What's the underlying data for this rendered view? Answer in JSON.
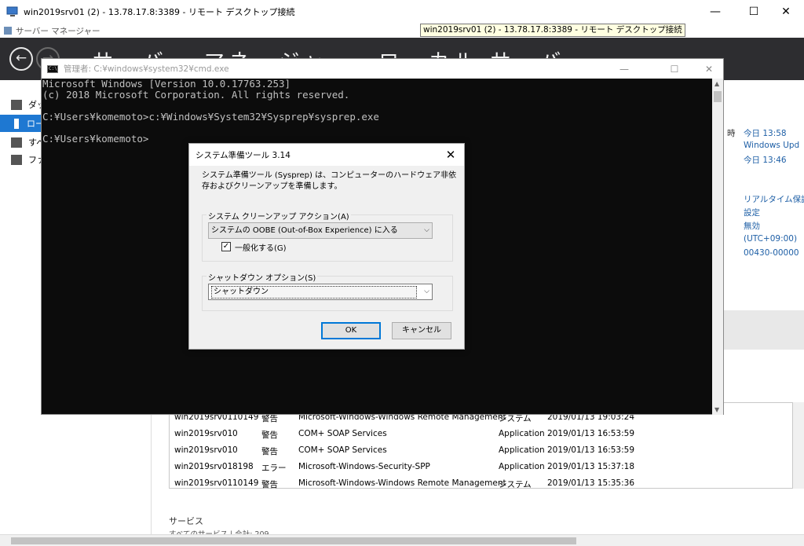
{
  "rdp": {
    "title": "win2019srv01 (2) - 13.78.17.8:3389 - リモート デスクトップ接続",
    "tooltip": "win2019srv01 (2) - 13.78.17.8:3389 - リモート デスクトップ接続",
    "minimize": "—",
    "maximize": "☐",
    "close": "✕"
  },
  "server_manager": {
    "app_title": "サーバー マネージャー",
    "banner_title": "サーバー マネージャー・ローカル サーバー",
    "sidebar": [
      {
        "label": "ダッ",
        "icon": "dashboard-icon"
      },
      {
        "label": "ロー",
        "icon": "local-server-icon"
      },
      {
        "label": "すべ",
        "icon": "all-servers-icon"
      },
      {
        "label": "ファ",
        "icon": "file-services-icon"
      }
    ],
    "right_col": {
      "hour_label": "時",
      "lines": [
        "今日 13:58",
        "Windows Upd",
        "今日 13:46",
        "",
        "リアルタイム保護",
        "設定",
        "無効",
        "(UTC+09:00)",
        "00430-00000"
      ]
    },
    "events": [
      {
        "server": "win2019srv01",
        "id": "10149",
        "level": "警告",
        "source": "Microsoft-Windows-Windows Remote Management",
        "log": "システム",
        "date": "2019/01/13 19:03:24"
      },
      {
        "server": "win2019srv01",
        "id": "0",
        "level": "警告",
        "source": "COM+ SOAP Services",
        "log": "Application",
        "date": "2019/01/13 16:53:59"
      },
      {
        "server": "win2019srv01",
        "id": "0",
        "level": "警告",
        "source": "COM+ SOAP Services",
        "log": "Application",
        "date": "2019/01/13 16:53:59"
      },
      {
        "server": "win2019srv01",
        "id": "8198",
        "level": "エラー",
        "source": "Microsoft-Windows-Security-SPP",
        "log": "Application",
        "date": "2019/01/13 15:37:18"
      },
      {
        "server": "win2019srv01",
        "id": "10149",
        "level": "警告",
        "source": "Microsoft-Windows-Windows Remote Management",
        "log": "システム",
        "date": "2019/01/13 15:35:36"
      }
    ],
    "services_title": "サービス",
    "services_subtitle": "すべてのサービス | 合計: 209"
  },
  "cmd": {
    "title": "管理者: C:¥windows¥system32¥cmd.exe",
    "icon_text": "C:\\",
    "lines": [
      "Microsoft Windows [Version 10.0.17763.253]",
      "(c) 2018 Microsoft Corporation. All rights reserved.",
      "",
      "C:¥Users¥komemoto>c:¥Windows¥System32¥Sysprep¥sysprep.exe",
      "",
      "C:¥Users¥komemoto>"
    ]
  },
  "sysprep": {
    "title": "システム準備ツール 3.14",
    "description": "システム準備ツール (Sysprep) は、コンピューターのハードウェア非依存およびクリーンアップを準備します。",
    "cleanup_group_label": "システム クリーンアップ アクション(A)",
    "cleanup_value": "システムの OOBE (Out-of-Box Experience) に入る",
    "generalize_label": "一般化する(G)",
    "generalize_checked": true,
    "shutdown_group_label": "シャットダウン オプション(S)",
    "shutdown_value": "シャットダウン",
    "ok_label": "OK",
    "cancel_label": "キャンセル"
  }
}
